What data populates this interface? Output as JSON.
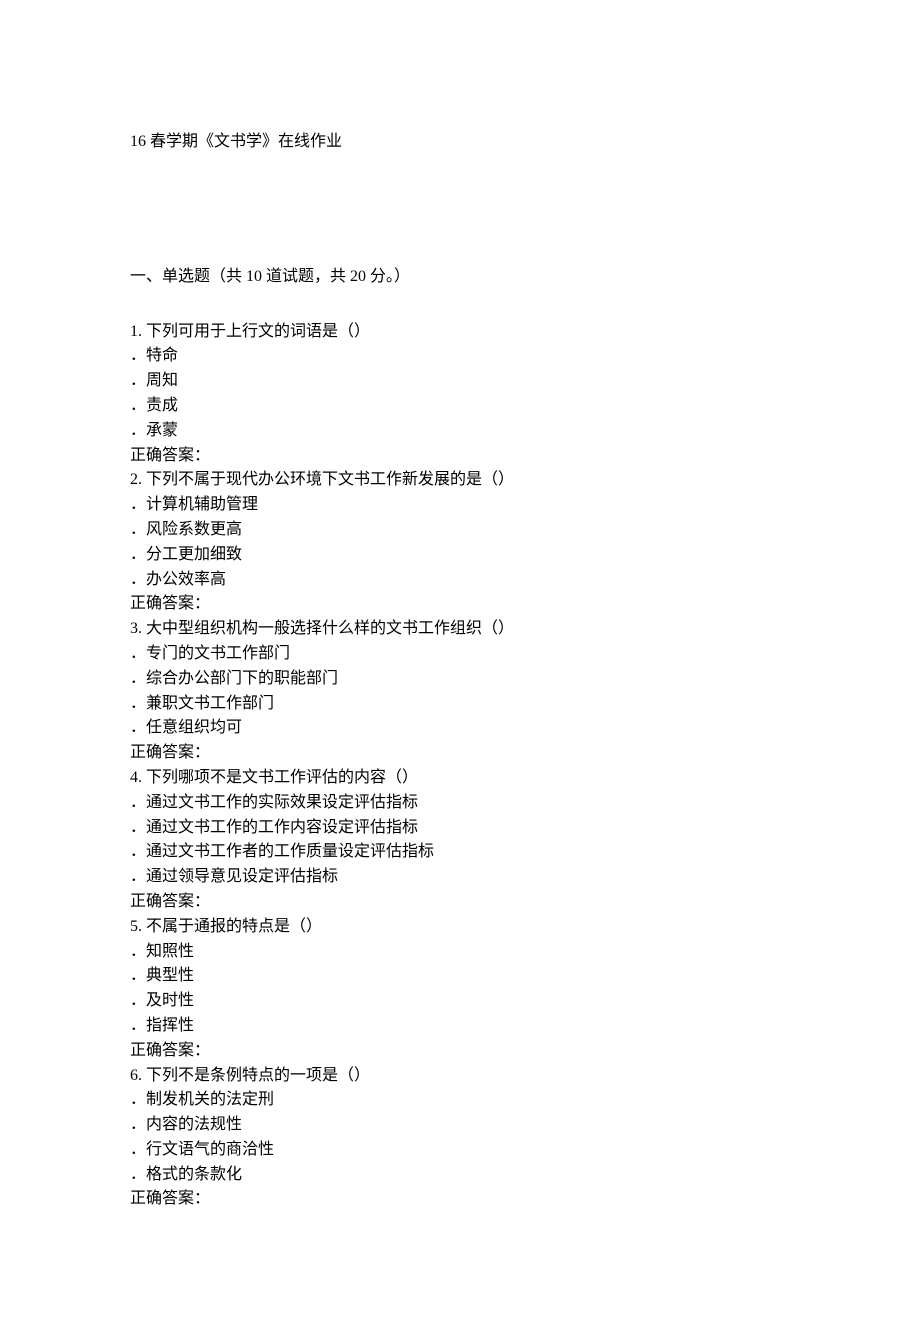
{
  "title": "16 春学期《文书学》在线作业",
  "section_header": "一、单选题（共 10 道试题，共 20 分。）",
  "answer_label": "正确答案：",
  "questions": [
    {
      "num": "1.    ",
      "stem": "下列可用于上行文的词语是（）",
      "options": [
        "．特命",
        "．周知",
        "．责成",
        "．承蒙"
      ]
    },
    {
      "num": "2.    ",
      "stem": "下列不属于现代办公环境下文书工作新发展的是（）",
      "options": [
        "．计算机辅助管理",
        "．风险系数更高",
        "．分工更加细致",
        "．办公效率高"
      ]
    },
    {
      "num": "3.    ",
      "stem": "大中型组织机构一般选择什么样的文书工作组织（）",
      "options": [
        "．专门的文书工作部门",
        "．综合办公部门下的职能部门",
        "．兼职文书工作部门",
        "．任意组织均可"
      ]
    },
    {
      "num": "4.    ",
      "stem": "下列哪项不是文书工作评估的内容（）",
      "options": [
        "．通过文书工作的实际效果设定评估指标",
        "．通过文书工作的工作内容设定评估指标",
        "．通过文书工作者的工作质量设定评估指标",
        "．通过领导意见设定评估指标"
      ]
    },
    {
      "num": "5.    ",
      "stem": "不属于通报的特点是（）",
      "options": [
        "．知照性",
        "．典型性",
        "．及时性",
        "．指挥性"
      ]
    },
    {
      "num": "6.    ",
      "stem": "下列不是条例特点的一项是（）",
      "options": [
        "．制发机关的法定刑",
        "．内容的法规性",
        "．行文语气的商洽性",
        "．格式的条款化"
      ]
    }
  ]
}
